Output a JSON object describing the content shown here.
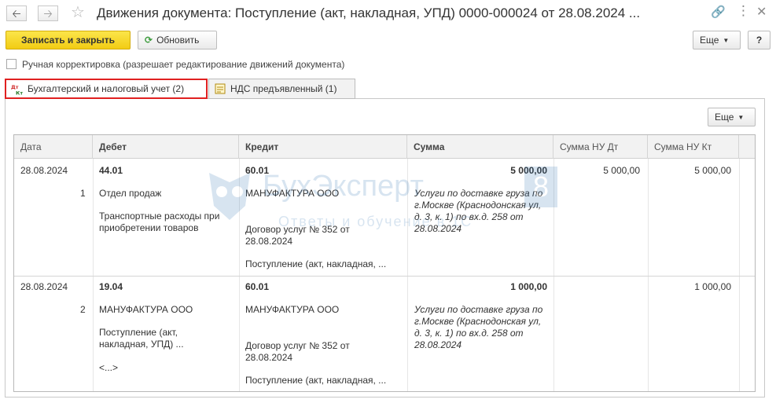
{
  "window": {
    "title": "Движения документа: Поступление (акт, накладная, УПД) 0000-000024 от 28.08.2024 ...",
    "back_icon": "arrow-left-icon",
    "forward_icon": "arrow-right-icon",
    "favorite_icon": "star-icon",
    "link_icon": "link-icon",
    "more_icon": "more-vertical-icon",
    "close_icon": "close-icon"
  },
  "toolbar": {
    "save_close_label": "Записать и закрыть",
    "refresh_label": "Обновить",
    "more_label": "Еще",
    "help_label": "?"
  },
  "manual_adjustment": {
    "label": "Ручная корректировка (разрешает редактирование движений документа)",
    "checked": false
  },
  "tabs": [
    {
      "label": "Бухгалтерский и налоговый учет (2)",
      "icon": "dt-kt-icon",
      "active": true
    },
    {
      "label": "НДС предъявленный (1)",
      "icon": "register-icon",
      "active": false
    }
  ],
  "panel": {
    "more_label": "Еще"
  },
  "table": {
    "columns": [
      "Дата",
      "Дебет",
      "Кредит",
      "Сумма",
      "Сумма НУ Дт",
      "Сумма НУ Кт"
    ],
    "rows": [
      {
        "date": "28.08.2024",
        "number": "1",
        "debit_account": "44.01",
        "debit_sub1": "Отдел продаж",
        "debit_sub2": "Транспортные расходы при приобретении товаров",
        "credit_account": "60.01",
        "credit_sub1": "МАНУФАКТУРА ООО",
        "credit_sub2": "Договор услуг № 352 от 28.08.2024",
        "credit_sub3": "Поступление (акт, накладная, ...",
        "amount": "5 000,00",
        "content": "Услуги по доставке груза по г.Москве (Краснодонская ул, д. 3, к. 1) по вх.д. 258 от 28.08.2024",
        "nu_dt": "5 000,00",
        "nu_kt": "5 000,00"
      },
      {
        "date": "28.08.2024",
        "number": "2",
        "debit_account": "19.04",
        "debit_sub1": "МАНУФАКТУРА ООО",
        "debit_sub2": "Поступление (акт, накладная, УПД) ...",
        "debit_sub3": "<...>",
        "credit_account": "60.01",
        "credit_sub1": "МАНУФАКТУРА ООО",
        "credit_sub2": "Договор услуг № 352 от 28.08.2024",
        "credit_sub3": "Поступление (акт, накладная, ...",
        "amount": "1 000,00",
        "content": "Услуги по доставке груза по г.Москве (Краснодонская ул, д. 3, к. 1) по вх.д. 258 от 28.08.2024",
        "nu_dt": "",
        "nu_kt": "1 000,00"
      }
    ]
  },
  "watermark": {
    "title": "БухЭксперт",
    "digit": "8",
    "subtitle": "Ответы и обучение в 1С"
  }
}
